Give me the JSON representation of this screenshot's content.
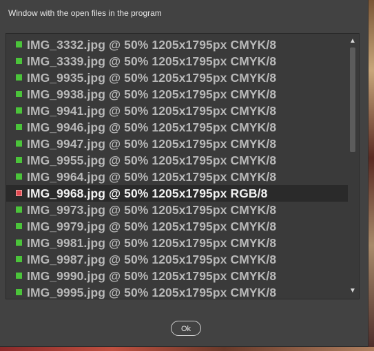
{
  "dialog": {
    "title": "Window with the open files in the program",
    "ok_label": "Ok"
  },
  "files": [
    {
      "label": "IMG_3332.jpg @ 50% 1205x1795px CMYK/8",
      "status": "green",
      "selected": false
    },
    {
      "label": "IMG_3339.jpg @ 50% 1205x1795px CMYK/8",
      "status": "green",
      "selected": false
    },
    {
      "label": "IMG_9935.jpg @ 50% 1205x1795px CMYK/8",
      "status": "green",
      "selected": false
    },
    {
      "label": "IMG_9938.jpg @ 50% 1205x1795px CMYK/8",
      "status": "green",
      "selected": false
    },
    {
      "label": "IMG_9941.jpg @ 50% 1205x1795px CMYK/8",
      "status": "green",
      "selected": false
    },
    {
      "label": "IMG_9946.jpg @ 50% 1205x1795px CMYK/8",
      "status": "green",
      "selected": false
    },
    {
      "label": "IMG_9947.jpg @ 50% 1205x1795px CMYK/8",
      "status": "green",
      "selected": false
    },
    {
      "label": "IMG_9955.jpg @ 50% 1205x1795px CMYK/8",
      "status": "green",
      "selected": false
    },
    {
      "label": "IMG_9964.jpg @ 50% 1205x1795px CMYK/8",
      "status": "green",
      "selected": false
    },
    {
      "label": "IMG_9968.jpg @ 50% 1205x1795px RGB/8",
      "status": "red",
      "selected": true
    },
    {
      "label": "IMG_9973.jpg @ 50% 1205x1795px CMYK/8",
      "status": "green",
      "selected": false
    },
    {
      "label": "IMG_9979.jpg @ 50% 1205x1795px CMYK/8",
      "status": "green",
      "selected": false
    },
    {
      "label": "IMG_9981.jpg @ 50% 1205x1795px CMYK/8",
      "status": "green",
      "selected": false
    },
    {
      "label": "IMG_9987.jpg @ 50% 1205x1795px CMYK/8",
      "status": "green",
      "selected": false
    },
    {
      "label": "IMG_9990.jpg @ 50% 1205x1795px CMYK/8",
      "status": "green",
      "selected": false
    },
    {
      "label": "IMG_9995.jpg @ 50% 1205x1795px CMYK/8",
      "status": "green",
      "selected": false
    }
  ],
  "scrollbar": {
    "up_icon": "triangle-up-icon",
    "down_icon": "triangle-down-icon",
    "scroll_position": 0
  },
  "colors": {
    "ok_status": "#4bc43a",
    "error_status": "#e04850",
    "dialog_bg": "#424242",
    "selected_row_bg": "#2a2a2a"
  }
}
